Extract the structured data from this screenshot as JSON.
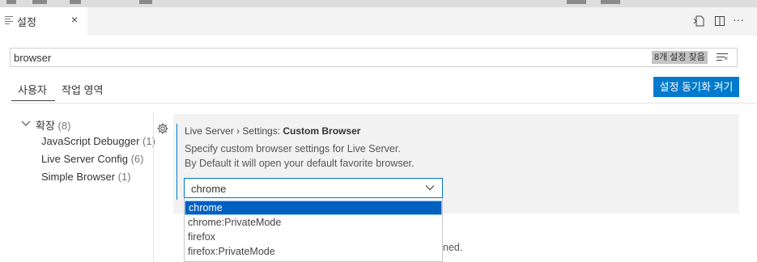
{
  "tab": {
    "icon": "settings-file-icon",
    "label": "설정",
    "close": "×"
  },
  "editor_actions": {
    "icons": [
      "open-settings-json-icon",
      "split-editor-icon",
      "more-actions-icon"
    ],
    "more": "···"
  },
  "search": {
    "value": "browser",
    "result_badge": "8개 설정 찾음",
    "filter_icon": "clear-filter-icon"
  },
  "scope_tabs": [
    {
      "label": "사용자",
      "active": true
    },
    {
      "label": "작업 영역",
      "active": false
    }
  ],
  "sync_button": {
    "label": "설정 동기화 켜기"
  },
  "toc": {
    "group": {
      "label": "확장",
      "count": "(8)"
    },
    "items": [
      {
        "label": "JavaScript Debugger",
        "count": "(1)"
      },
      {
        "label": "Live Server Config",
        "count": "(6)"
      },
      {
        "label": "Simple Browser",
        "count": "(1)"
      }
    ]
  },
  "setting": {
    "category": "Live Server › Settings: ",
    "name": "Custom Browser",
    "description_1": "Specify custom browser settings for Live Server.",
    "description_2": "By Default it will open your default favorite browser.",
    "value": "chrome",
    "options": [
      {
        "label": "chrome",
        "selected": true
      },
      {
        "label": "chrome:PrivateMode",
        "selected": false
      },
      {
        "label": "firefox",
        "selected": false
      },
      {
        "label": "firefox:PrivateMode",
        "selected": false
      }
    ]
  },
  "partial_text": "ned.",
  "colors": {
    "accent": "#007acc",
    "selected_option": "#0060c0"
  }
}
